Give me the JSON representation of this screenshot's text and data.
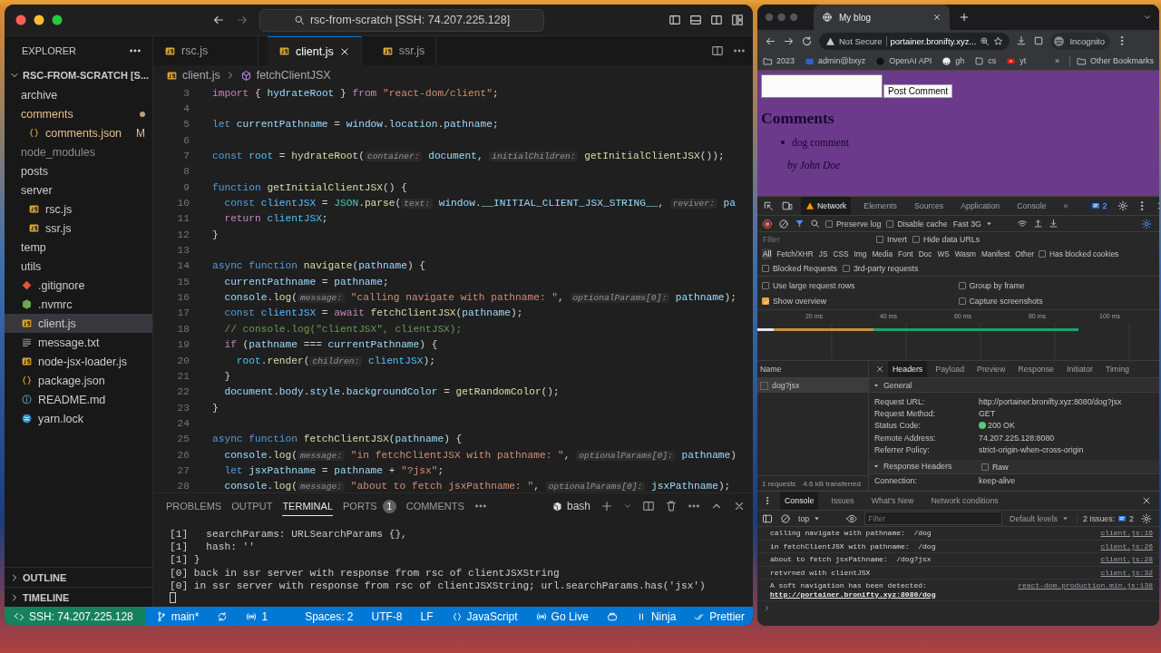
{
  "editor_window": {
    "title": "rsc-from-scratch [SSH: 74.207.225.128]",
    "explorer": {
      "heading": "EXPLORER",
      "root": "RSC-FROM-SCRATCH [S...",
      "tree": [
        {
          "name": "archive",
          "kind": "folder",
          "selected": false,
          "modified": false,
          "ignored": false
        },
        {
          "name": "comments",
          "kind": "folder",
          "selected": false,
          "modified": true,
          "ignored": false,
          "children": [
            {
              "name": "comments.json",
              "kind": "json",
              "selected": false,
              "modified": true,
              "ignored": false,
              "badge": "M"
            }
          ]
        },
        {
          "name": "node_modules",
          "kind": "folder",
          "selected": false,
          "modified": false,
          "ignored": true
        },
        {
          "name": "posts",
          "kind": "folder",
          "selected": false
        },
        {
          "name": "server",
          "kind": "folder",
          "selected": false,
          "children": [
            {
              "name": "rsc.js",
              "kind": "js",
              "selected": false
            },
            {
              "name": "ssr.js",
              "kind": "js",
              "selected": false
            }
          ]
        },
        {
          "name": "temp",
          "kind": "folder",
          "selected": false
        },
        {
          "name": "utils",
          "kind": "folder",
          "selected": false
        },
        {
          "name": ".gitignore",
          "kind": "git",
          "selected": false
        },
        {
          "name": ".nvmrc",
          "kind": "nvmrc",
          "selected": false
        },
        {
          "name": "client.js",
          "kind": "js",
          "selected": true
        },
        {
          "name": "message.txt",
          "kind": "txt",
          "selected": false
        },
        {
          "name": "node-jsx-loader.js",
          "kind": "js",
          "selected": false
        },
        {
          "name": "package.json",
          "kind": "json",
          "selected": false
        },
        {
          "name": "README.md",
          "kind": "md",
          "selected": false
        },
        {
          "name": "yarn.lock",
          "kind": "yarn",
          "selected": false
        }
      ],
      "sections": [
        "OUTLINE",
        "TIMELINE"
      ]
    },
    "tabs": [
      {
        "label": "rsc.js",
        "selected": false
      },
      {
        "label": "client.js",
        "selected": true
      },
      {
        "label": "ssr.js",
        "selected": false
      }
    ],
    "breadcrumb": [
      "client.js",
      "fetchClientJSX"
    ],
    "code": [
      {
        "number": "3",
        "tokens": [
          {
            "kind": "ctl",
            "text": "import"
          },
          {
            "kind": "p",
            "text": " { "
          },
          {
            "kind": "var",
            "text": "hydrateRoot"
          },
          {
            "kind": "p",
            "text": " } "
          },
          {
            "kind": "ctl",
            "text": "from"
          },
          {
            "kind": "str",
            "text": " \"react-dom/client\""
          },
          {
            "kind": "p",
            "text": ";"
          }
        ]
      },
      {
        "number": "4"
      },
      {
        "number": "5",
        "tokens": [
          {
            "kind": "kw",
            "text": "let"
          },
          {
            "kind": "var",
            "text": " currentPathname"
          },
          {
            "kind": "p",
            "text": " = "
          },
          {
            "kind": "var",
            "text": "window"
          },
          {
            "kind": "p",
            "text": "."
          },
          {
            "kind": "var",
            "text": "location"
          },
          {
            "kind": "p",
            "text": "."
          },
          {
            "kind": "var",
            "text": "pathname"
          },
          {
            "kind": "p",
            "text": ";"
          }
        ]
      },
      {
        "number": "6"
      },
      {
        "number": "7",
        "tokens": [
          {
            "kind": "kw",
            "text": "const"
          },
          {
            "kind": "cst",
            "text": " root"
          },
          {
            "kind": "p",
            "text": " = "
          },
          {
            "kind": "fn",
            "text": "hydrateRoot"
          },
          {
            "kind": "p",
            "text": "("
          },
          {
            "kind": "hint",
            "text": "container:"
          },
          {
            "kind": "var",
            "text": " document"
          },
          {
            "kind": "p",
            "text": ", "
          },
          {
            "kind": "hint",
            "text": "initialChildren:"
          },
          {
            "kind": "fn",
            "text": " getInitialClientJSX"
          },
          {
            "kind": "p",
            "text": "());"
          }
        ]
      },
      {
        "number": "8"
      },
      {
        "number": "9",
        "tokens": [
          {
            "kind": "kw",
            "text": "function"
          },
          {
            "kind": "fn",
            "text": " getInitialClientJSX"
          },
          {
            "kind": "p",
            "text": "() {"
          }
        ]
      },
      {
        "number": "10",
        "tokens": [
          {
            "kind": "kw",
            "text": "  const"
          },
          {
            "kind": "cst",
            "text": " clientJSX"
          },
          {
            "kind": "p",
            "text": " = "
          },
          {
            "kind": "cls",
            "text": "JSON"
          },
          {
            "kind": "p",
            "text": "."
          },
          {
            "kind": "fn",
            "text": "parse"
          },
          {
            "kind": "p",
            "text": "("
          },
          {
            "kind": "hint",
            "text": "text:"
          },
          {
            "kind": "var",
            "text": " window"
          },
          {
            "kind": "p",
            "text": "."
          },
          {
            "kind": "var",
            "text": "__INITIAL_CLIENT_JSX_STRING__"
          },
          {
            "kind": "p",
            "text": ", "
          },
          {
            "kind": "hint",
            "text": "reviver:"
          },
          {
            "kind": "var",
            "text": " pa"
          }
        ]
      },
      {
        "number": "11",
        "tokens": [
          {
            "kind": "ctl",
            "text": "  return"
          },
          {
            "kind": "cst",
            "text": " clientJSX"
          },
          {
            "kind": "p",
            "text": ";"
          }
        ]
      },
      {
        "number": "12",
        "tokens": [
          {
            "kind": "p",
            "text": "}"
          }
        ]
      },
      {
        "number": "13"
      },
      {
        "number": "14",
        "tokens": [
          {
            "kind": "kw",
            "text": "async function"
          },
          {
            "kind": "fn",
            "text": " navigate"
          },
          {
            "kind": "p",
            "text": "("
          },
          {
            "kind": "var",
            "text": "pathname"
          },
          {
            "kind": "p",
            "text": ") {"
          }
        ]
      },
      {
        "number": "15",
        "tokens": [
          {
            "kind": "var",
            "text": "  currentPathname"
          },
          {
            "kind": "p",
            "text": " = "
          },
          {
            "kind": "var",
            "text": "pathname"
          },
          {
            "kind": "p",
            "text": ";"
          }
        ]
      },
      {
        "number": "16",
        "tokens": [
          {
            "kind": "var",
            "text": "  console"
          },
          {
            "kind": "p",
            "text": "."
          },
          {
            "kind": "fn",
            "text": "log"
          },
          {
            "kind": "p",
            "text": "("
          },
          {
            "kind": "hint",
            "text": "message:"
          },
          {
            "kind": "str",
            "text": " \"calling navigate with pathname: \""
          },
          {
            "kind": "p",
            "text": ", "
          },
          {
            "kind": "hint",
            "text": "optionalParams[0]:"
          },
          {
            "kind": "var",
            "text": " pathname"
          },
          {
            "kind": "p",
            "text": ");"
          }
        ]
      },
      {
        "number": "17",
        "tokens": [
          {
            "kind": "kw",
            "text": "  const"
          },
          {
            "kind": "cst",
            "text": " clientJSX"
          },
          {
            "kind": "p",
            "text": " = "
          },
          {
            "kind": "ctl",
            "text": "await"
          },
          {
            "kind": "fn",
            "text": " fetchClientJSX"
          },
          {
            "kind": "p",
            "text": "("
          },
          {
            "kind": "var",
            "text": "pathname"
          },
          {
            "kind": "p",
            "text": ");"
          }
        ]
      },
      {
        "number": "18",
        "tokens": [
          {
            "kind": "cm",
            "text": "  // console.log(\"clientJSX\", clientJSX);"
          }
        ]
      },
      {
        "number": "19",
        "tokens": [
          {
            "kind": "ctl",
            "text": "  if"
          },
          {
            "kind": "p",
            "text": " ("
          },
          {
            "kind": "var",
            "text": "pathname"
          },
          {
            "kind": "p",
            "text": " === "
          },
          {
            "kind": "var",
            "text": "currentPathname"
          },
          {
            "kind": "p",
            "text": ") {"
          }
        ]
      },
      {
        "number": "20",
        "tokens": [
          {
            "kind": "cst",
            "text": "    root"
          },
          {
            "kind": "p",
            "text": "."
          },
          {
            "kind": "fn",
            "text": "render"
          },
          {
            "kind": "p",
            "text": "("
          },
          {
            "kind": "hint",
            "text": "children:"
          },
          {
            "kind": "cst",
            "text": " clientJSX"
          },
          {
            "kind": "p",
            "text": ");"
          }
        ]
      },
      {
        "number": "21",
        "tokens": [
          {
            "kind": "p",
            "text": "  }"
          }
        ]
      },
      {
        "number": "22",
        "tokens": [
          {
            "kind": "var",
            "text": "  document"
          },
          {
            "kind": "p",
            "text": "."
          },
          {
            "kind": "var",
            "text": "body"
          },
          {
            "kind": "p",
            "text": "."
          },
          {
            "kind": "var",
            "text": "style"
          },
          {
            "kind": "p",
            "text": "."
          },
          {
            "kind": "var",
            "text": "backgroundColor"
          },
          {
            "kind": "p",
            "text": " = "
          },
          {
            "kind": "fn",
            "text": "getRandomColor"
          },
          {
            "kind": "p",
            "text": "();"
          }
        ]
      },
      {
        "number": "23",
        "tokens": [
          {
            "kind": "p",
            "text": "}"
          }
        ]
      },
      {
        "number": "24"
      },
      {
        "number": "25",
        "tokens": [
          {
            "kind": "kw",
            "text": "async function"
          },
          {
            "kind": "fn",
            "text": " fetchClientJSX"
          },
          {
            "kind": "p",
            "text": "("
          },
          {
            "kind": "var",
            "text": "pathname"
          },
          {
            "kind": "p",
            "text": ") {"
          }
        ]
      },
      {
        "number": "26",
        "tokens": [
          {
            "kind": "var",
            "text": "  console"
          },
          {
            "kind": "p",
            "text": "."
          },
          {
            "kind": "fn",
            "text": "log"
          },
          {
            "kind": "p",
            "text": "("
          },
          {
            "kind": "hint",
            "text": "message:"
          },
          {
            "kind": "str",
            "text": " \"in fetchClientJSX with pathname: \""
          },
          {
            "kind": "p",
            "text": ", "
          },
          {
            "kind": "hint",
            "text": "optionalParams[0]:"
          },
          {
            "kind": "var",
            "text": " pathname"
          },
          {
            "kind": "p",
            "text": ")"
          }
        ]
      },
      {
        "number": "27",
        "tokens": [
          {
            "kind": "kw",
            "text": "  let"
          },
          {
            "kind": "var",
            "text": " jsxPathname"
          },
          {
            "kind": "p",
            "text": " = "
          },
          {
            "kind": "var",
            "text": "pathname"
          },
          {
            "kind": "p",
            "text": " + "
          },
          {
            "kind": "str",
            "text": "\"?jsx\""
          },
          {
            "kind": "p",
            "text": ";"
          }
        ]
      },
      {
        "number": "28",
        "tokens": [
          {
            "kind": "var",
            "text": "  console"
          },
          {
            "kind": "p",
            "text": "."
          },
          {
            "kind": "fn",
            "text": "log"
          },
          {
            "kind": "p",
            "text": "("
          },
          {
            "kind": "hint",
            "text": "message:"
          },
          {
            "kind": "str",
            "text": " \"about to fetch jsxPathname: \""
          },
          {
            "kind": "p",
            "text": ", "
          },
          {
            "kind": "hint",
            "text": "optionalParams[0]:"
          },
          {
            "kind": "var",
            "text": " jsxPathname"
          },
          {
            "kind": "p",
            "text": ");"
          }
        ]
      }
    ],
    "panel": {
      "tabs": [
        {
          "label": "PROBLEMS",
          "selected": false
        },
        {
          "label": "OUTPUT",
          "selected": false
        },
        {
          "label": "TERMINAL",
          "selected": true
        },
        {
          "label": "PORTS",
          "selected": false,
          "badge": "1"
        },
        {
          "label": "COMMENTS",
          "selected": false
        }
      ],
      "shell": "bash",
      "terminal": [
        "[1]   searchParams: URLSearchParams {},",
        "[1]   hash: ''",
        "[1] }",
        "[0] back in ssr server with response from rsc of clientJSXString",
        "[0] in ssr server with response from rsc of clientJSXString; url.searchParams.has('jsx')"
      ]
    },
    "status_left": [
      {
        "kind": "remote",
        "label": "SSH: 74.207.225.128"
      },
      {
        "kind": "branch",
        "label": "main*"
      },
      {
        "kind": "sync"
      },
      {
        "kind": "ports",
        "label": "1"
      }
    ],
    "status_right": [
      {
        "kind": "text",
        "label": "Spaces: 2"
      },
      {
        "kind": "text",
        "label": "UTF-8"
      },
      {
        "kind": "text",
        "label": "LF"
      },
      {
        "kind": "language",
        "label": "JavaScript"
      },
      {
        "kind": "live",
        "label": "Go Live"
      },
      {
        "kind": "copilot"
      },
      {
        "kind": "ninja",
        "label": "Ninja"
      },
      {
        "kind": "prettier",
        "label": "Prettier"
      }
    ]
  },
  "browser_window": {
    "tab": "My blog",
    "security": "Not Secure",
    "url": "portainer.bronifty.xyz...",
    "profile": "Incognito",
    "bookmarks": [
      {
        "label": "2023",
        "kind": "folder"
      },
      {
        "label": "admin@bxyz",
        "kind": "mail"
      },
      {
        "label": "OpenAI API",
        "kind": "dark"
      },
      {
        "label": "gh",
        "kind": "round"
      },
      {
        "label": "cs",
        "kind": "square"
      },
      {
        "label": "yt",
        "kind": "video"
      }
    ],
    "bookmarks_more": "»",
    "other_bookmarks": "Other Bookmarks",
    "page": {
      "button": "Post Comment",
      "heading": "Comments",
      "comments": [
        {
          "text": "dog comment",
          "author": "by John Doe"
        }
      ]
    },
    "devtools": {
      "tabs": [
        {
          "label": "Network",
          "selected": true,
          "warning": true
        },
        {
          "label": "Elements",
          "selected": false
        },
        {
          "label": "Sources",
          "selected": false
        },
        {
          "label": "Application",
          "selected": false
        },
        {
          "label": "Console",
          "selected": false
        }
      ],
      "more_tabs": "»",
      "issues_count": "2",
      "toolbar": [
        {
          "label": "Preserve log",
          "checked": false
        },
        {
          "label": "Disable cache",
          "checked": false
        }
      ],
      "throttling": "Fast 3G",
      "filter_placeholder": "Filter",
      "filter_options": [
        {
          "label": "Invert",
          "checked": false
        },
        {
          "label": "Hide data URLs",
          "checked": false
        }
      ],
      "types": [
        {
          "label": "All",
          "selected": true
        },
        {
          "label": "Fetch/XHR",
          "selected": false
        },
        {
          "label": "JS",
          "selected": false
        },
        {
          "label": "CSS",
          "selected": false
        },
        {
          "label": "Img",
          "selected": false
        },
        {
          "label": "Media",
          "selected": false
        },
        {
          "label": "Font",
          "selected": false
        },
        {
          "label": "Doc",
          "selected": false
        },
        {
          "label": "WS",
          "selected": false
        },
        {
          "label": "Wasm",
          "selected": false
        },
        {
          "label": "Manifest",
          "selected": false
        },
        {
          "label": "Other",
          "selected": false
        }
      ],
      "blocked_cookies": {
        "label": "Has blocked cookies",
        "checked": false
      },
      "request_filters": [
        {
          "label": "Blocked Requests",
          "checked": false
        },
        {
          "label": "3rd-party requests",
          "checked": false
        }
      ],
      "settings": [
        {
          "label": "Use large request rows",
          "checked": false
        },
        {
          "label": "Group by frame",
          "checked": false
        },
        {
          "label": "Show overview",
          "checked": true
        },
        {
          "label": "Capture screenshots",
          "checked": false
        }
      ],
      "overview_ticks": [
        "20 ms",
        "40 ms",
        "60 ms",
        "80 ms",
        "100 ms"
      ],
      "requests": {
        "header": "Name",
        "rows": [
          {
            "name": "dog?jsx",
            "selected": true
          }
        ],
        "summary": [
          "1 requests",
          "4.6 kB transferred"
        ]
      },
      "detail_tabs": [
        {
          "label": "Headers",
          "selected": true
        },
        {
          "label": "Payload",
          "selected": false
        },
        {
          "label": "Preview",
          "selected": false
        },
        {
          "label": "Response",
          "selected": false
        },
        {
          "label": "Initiator",
          "selected": false
        },
        {
          "label": "Timing",
          "selected": false
        }
      ],
      "general": {
        "title": "General",
        "rows": [
          {
            "key": "Request URL:",
            "value": "http://portainer.bronifty.xyz:8080/dog?jsx"
          },
          {
            "key": "Request Method:",
            "value": "GET"
          },
          {
            "key": "Status Code:",
            "value": "200 OK",
            "color": "#5cc77a"
          },
          {
            "key": "Remote Address:",
            "value": "74.207.225.128:8080"
          },
          {
            "key": "Referrer Policy:",
            "value": "strict-origin-when-cross-origin"
          }
        ]
      },
      "response_headers": {
        "title": "Response Headers",
        "raw": {
          "label": "Raw",
          "checked": false
        },
        "rows": [
          {
            "key": "Connection:",
            "value": "keep-alive"
          }
        ]
      }
    },
    "console": {
      "tabs": [
        {
          "label": "Console",
          "selected": true
        },
        {
          "label": "Issues",
          "selected": false
        },
        {
          "label": "What's New",
          "selected": false
        },
        {
          "label": "Network conditions",
          "selected": false
        }
      ],
      "context": "top",
      "filter_placeholder": "Filter",
      "levels": "Default levels",
      "issues_label": "2 Issues:",
      "issues_count": "2",
      "messages": [
        {
          "text": "calling navigate with pathname:  /dog",
          "source": "client.js:16"
        },
        {
          "text": "in fetchClientJSX with pathname:  /dog",
          "source": "client.js:26"
        },
        {
          "text": "about to fetch jsxPathname:  /dog?jsx",
          "source": "client.js:28"
        },
        {
          "text": "retvrned with clientJSX",
          "source": "client.js:32"
        },
        {
          "text": "A soft navigation has been detected: ",
          "link": "http://portainer.bronifty.xyz:8080/dog",
          "source": "react-dom.production.min.js:138"
        }
      ]
    }
  }
}
